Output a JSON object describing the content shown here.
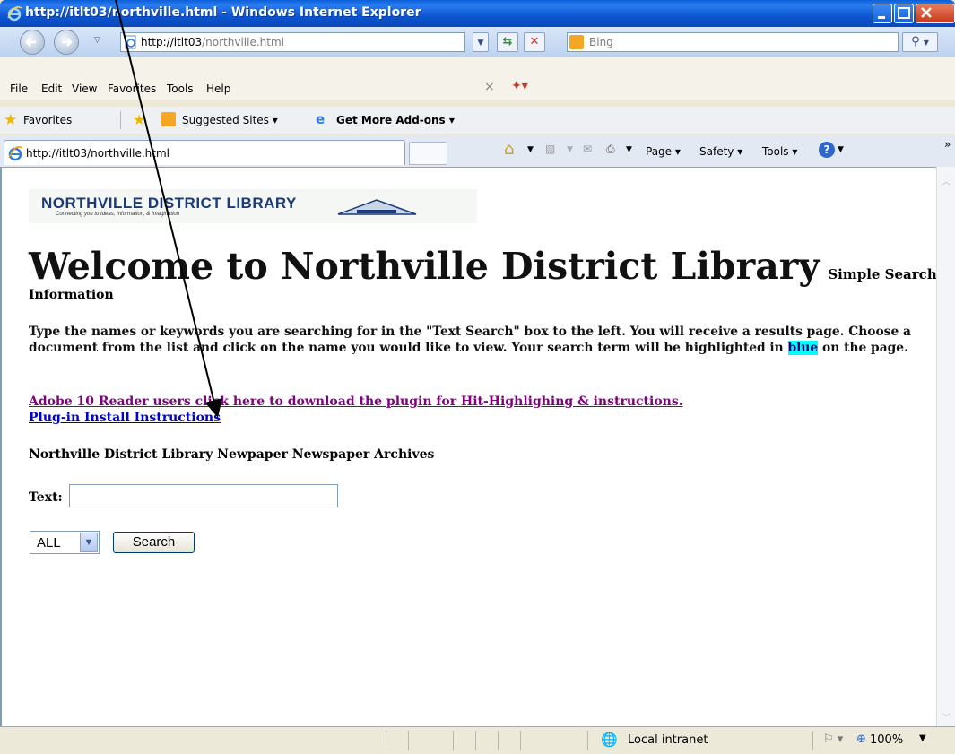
{
  "window": {
    "title": "http://itlt03/northville.html - Windows Internet Explorer"
  },
  "address_bar": {
    "url_host": "http://itlt03",
    "url_path": "/northville.html",
    "search_placeholder": "Bing"
  },
  "menu": {
    "items": [
      "File",
      "Edit",
      "View",
      "Favorites",
      "Tools",
      "Help"
    ]
  },
  "favorites_bar": {
    "favorites_label": "Favorites",
    "suggested_sites": "Suggested Sites",
    "get_more_addons": "Get More Add-ons"
  },
  "tab": {
    "title": "http://itlt03/northville.html"
  },
  "command_bar": {
    "page": "Page",
    "safety": "Safety",
    "tools": "Tools"
  },
  "page": {
    "logo_name": "NORTHVILLE DISTRICT LIBRARY",
    "logo_tagline": "Connecting you to Ideas, Information, & Imagination",
    "welcome": "Welcome to Northville District Library",
    "simple_search": "Simple Search",
    "information": "Information",
    "paragraph_before": "Type the names or keywords you are searching for in the \"Text Search\" box to the left. You will receive a results page. Choose a document from the list and click on the name you would like to view. Your search term will be highlighted in",
    "highlight_word": "blue",
    "paragraph_after": "on the page.",
    "link_adobe": "Adobe 10 Reader users click here to download the plugin for Hit-Highlighing & instructions.",
    "link_plugin": "Plug-in Install Instructions",
    "archives_title": "Northville District Library Newpaper Newspaper Archives",
    "text_label": "Text:",
    "text_value": "",
    "select_value": "ALL",
    "search_button": "Search"
  },
  "status_bar": {
    "zone": "Local intranet",
    "zoom": "100%"
  },
  "colors": {
    "link_visited": "#800080",
    "link": "#0000cc",
    "highlight": "#00ffff"
  }
}
